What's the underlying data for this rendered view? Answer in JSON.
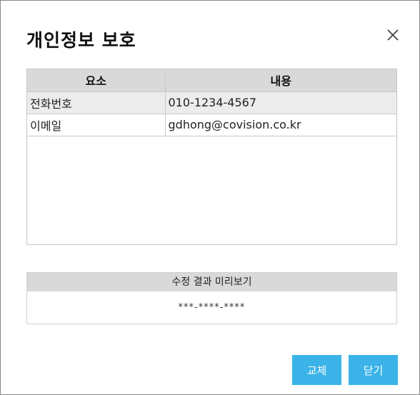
{
  "dialog": {
    "title": "개인정보 보호"
  },
  "table": {
    "headers": [
      "요소",
      "내용"
    ],
    "rows": [
      {
        "element": "전화번호",
        "content": "010-1234-4567"
      },
      {
        "element": "이메일",
        "content": "gdhong@covision.co.kr"
      }
    ]
  },
  "preview": {
    "label": "수정 결과 미리보기",
    "value": "***-****-****"
  },
  "buttons": {
    "replace": "교체",
    "close": "닫기"
  },
  "colors": {
    "accent": "#3bb3e8",
    "header_bg": "#d9d9d9",
    "selected_row_bg": "#ececec"
  },
  "icons": {
    "close": "close-icon"
  }
}
